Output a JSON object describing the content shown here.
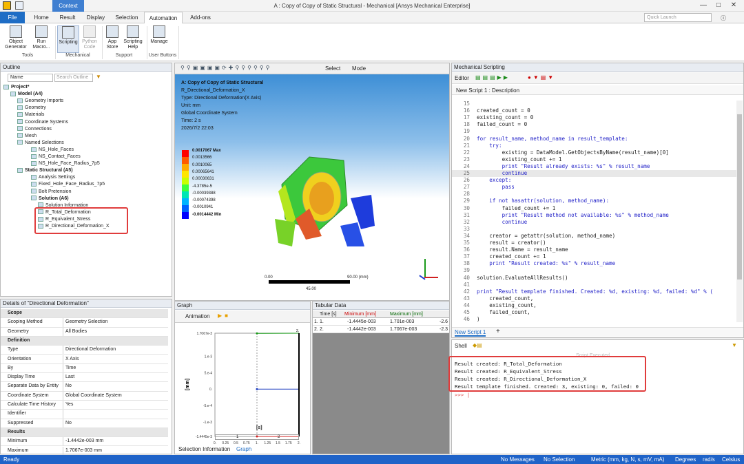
{
  "titlebar": {
    "context": "Context",
    "title": "A : Copy of Copy of Static Structural - Mechanical [Ansys Mechanical Enterprise]"
  },
  "ribbon_tabs": [
    "File",
    "Home",
    "Result",
    "Display",
    "Selection",
    "Automation",
    "Add-ons"
  ],
  "quick_launch": "Quick Launch",
  "ribbon": {
    "buttons": [
      {
        "label": "Object\nGenerator"
      },
      {
        "label": "Run\nMacro..."
      },
      {
        "label": "Scripting"
      },
      {
        "label": "Python\nCode"
      },
      {
        "label": "App\nStore"
      },
      {
        "label": "Scripting\nHelp"
      },
      {
        "label": "Manage"
      }
    ],
    "groups": [
      "Tools",
      "Mechanical",
      "Support",
      "User Buttons"
    ]
  },
  "outline": {
    "title": "Outline",
    "name_label": "Name",
    "search_placeholder": "Search Outline",
    "tree": [
      {
        "label": "Project*",
        "bold": true
      },
      {
        "label": "Model (A4)",
        "bold": true
      },
      {
        "label": "Geometry Imports"
      },
      {
        "label": "Geometry"
      },
      {
        "label": "Materials"
      },
      {
        "label": "Coordinate Systems"
      },
      {
        "label": "Connections"
      },
      {
        "label": "Mesh"
      },
      {
        "label": "Named Selections"
      },
      {
        "label": "NS_Hole_Faces"
      },
      {
        "label": "NS_Contact_Faces"
      },
      {
        "label": "NS_Hole_Face_Radius_7p5"
      },
      {
        "label": "Static Structural (A5)",
        "bold": true
      },
      {
        "label": "Analysis Settings"
      },
      {
        "label": "Fixed_Hole_Face_Radius_7p5"
      },
      {
        "label": "Bolt Pretension"
      },
      {
        "label": "Solution (A6)",
        "bold": true
      },
      {
        "label": "Solution Information"
      },
      {
        "label": "R_Total_Deformation"
      },
      {
        "label": "R_Equivalent_Stress"
      },
      {
        "label": "R_Directional_Deformation_X"
      }
    ]
  },
  "details": {
    "title": "Details of \"Directional Deformation\"",
    "rows": [
      {
        "k": "Scope",
        "v": "",
        "sec": true
      },
      {
        "k": "Scoping Method",
        "v": "Geometry Selection"
      },
      {
        "k": "Geometry",
        "v": "All Bodies"
      },
      {
        "k": "Definition",
        "v": "",
        "sec": true
      },
      {
        "k": "Type",
        "v": "Directional Deformation"
      },
      {
        "k": "Orientation",
        "v": "X Axis"
      },
      {
        "k": "By",
        "v": "Time"
      },
      {
        "k": "Display Time",
        "v": "Last"
      },
      {
        "k": "Separate Data by Entity",
        "v": "No"
      },
      {
        "k": "Coordinate System",
        "v": "Global Coordinate System"
      },
      {
        "k": "Calculate Time History",
        "v": "Yes"
      },
      {
        "k": "Identifier",
        "v": ""
      },
      {
        "k": "Suppressed",
        "v": "No"
      },
      {
        "k": "Results",
        "v": "",
        "sec": true
      },
      {
        "k": "Minimum",
        "v": "-1.4442e-003 mm"
      },
      {
        "k": "Maximum",
        "v": "1.7067e-003 mm"
      }
    ]
  },
  "viewport": {
    "select": "Select",
    "mode": "Mode",
    "info": [
      "A: Copy of Copy of Static Structural",
      "R_Directional_Deformation_X",
      "Type: Directional Deformation(X Axis)",
      "Unit: mm",
      "Global Coordinate System",
      "Time: 2 s",
      "2026/7/2 22:03"
    ],
    "legend": [
      "0.0017067 Max",
      "0.0013566",
      "0.0010065",
      "0.00065641",
      "0.00030631",
      "-4.3785e-5",
      "-0.00039388",
      "-0.00074398",
      "-0.0010941",
      "-0.0014442 Min"
    ],
    "legend_colors": [
      "#ff0000",
      "#ff5a00",
      "#ffaa00",
      "#ffe600",
      "#c8ff00",
      "#3cff3c",
      "#00e6b4",
      "#00b4ff",
      "#0064ff",
      "#0000ff"
    ],
    "scale": {
      "left": "0.00",
      "right": "90.00 (mm)",
      "mid": "45.00"
    }
  },
  "graph": {
    "title": "Graph",
    "animation": "Animation",
    "ylabel": "[mm]",
    "xlabel": "[s]",
    "yticks": [
      "1.7067e-3",
      "1.e-3",
      "5.e-4",
      "0.",
      "-5.e-4",
      "-1.e-3",
      "-1.4445e-3"
    ],
    "xticks": [
      "0.",
      "0.25",
      "0.5",
      "0.75",
      "1.",
      "1.25",
      "1.5",
      "1.75",
      "2."
    ],
    "bottom": [
      "1",
      "2"
    ],
    "tabs": [
      "Selection Information",
      "Graph"
    ]
  },
  "tabular": {
    "title": "Tabular Data",
    "headers": [
      "Time [s]",
      "Minimum [mm]",
      "Maximum [mm]"
    ],
    "rows": [
      [
        "1.",
        "1.",
        "-1.4445e-003",
        "1.701e-003",
        "-2.6"
      ],
      [
        "2.",
        "2.",
        "-1.4442e-003",
        "1.7067e-003",
        "-2.3"
      ]
    ]
  },
  "scripting": {
    "title": "Mechanical Scripting",
    "editor": "Editor",
    "doc_tab": "New Script 1 : Description",
    "bottom_tab": "New Script 1",
    "lines": [
      {
        "n": "15",
        "t": ""
      },
      {
        "n": "16",
        "t": "created_count = 0"
      },
      {
        "n": "17",
        "t": "existing_count = 0"
      },
      {
        "n": "18",
        "t": "failed_count = 0"
      },
      {
        "n": "19",
        "t": ""
      },
      {
        "n": "20",
        "t": "for result_name, method_name in result_template:"
      },
      {
        "n": "21",
        "t": "    try:"
      },
      {
        "n": "22",
        "t": "        existing = DataModel.GetObjectsByName(result_name)[0]"
      },
      {
        "n": "23",
        "t": "        existing_count += 1"
      },
      {
        "n": "24",
        "t": "        print \"Result already exists: %s\" % result_name"
      },
      {
        "n": "25",
        "t": "        continue"
      },
      {
        "n": "26",
        "t": "    except:"
      },
      {
        "n": "27",
        "t": "        pass"
      },
      {
        "n": "28",
        "t": ""
      },
      {
        "n": "29",
        "t": "    if not hasattr(solution, method_name):"
      },
      {
        "n": "30",
        "t": "        failed_count += 1"
      },
      {
        "n": "31",
        "t": "        print \"Result method not available: %s\" % method_name"
      },
      {
        "n": "32",
        "t": "        continue"
      },
      {
        "n": "33",
        "t": ""
      },
      {
        "n": "34",
        "t": "    creator = getattr(solution, method_name)"
      },
      {
        "n": "35",
        "t": "    result = creator()"
      },
      {
        "n": "36",
        "t": "    result.Name = result_name"
      },
      {
        "n": "37",
        "t": "    created_count += 1"
      },
      {
        "n": "38",
        "t": "    print \"Result created: %s\" % result_name"
      },
      {
        "n": "39",
        "t": ""
      },
      {
        "n": "40",
        "t": "solution.EvaluateAllResults()"
      },
      {
        "n": "41",
        "t": ""
      },
      {
        "n": "42",
        "t": "print \"Result template finished. Created: %d, existing: %d, failed: %d\" % ("
      },
      {
        "n": "43",
        "t": "    created_count,"
      },
      {
        "n": "44",
        "t": "    existing_count,"
      },
      {
        "n": "45",
        "t": "    failed_count,"
      },
      {
        "n": "46",
        "t": ")"
      }
    ]
  },
  "shell": {
    "title": "Shell",
    "executed": "Script Executed",
    "lines": [
      "Result created: R_Total_Deformation",
      "Result created: R_Equivalent_Stress",
      "Result created: R_Directional_Deformation_X",
      "Result template finished. Created: 3, existing: 0, failed: 0"
    ],
    "prompt": ">>> |"
  },
  "status": {
    "ready": "Ready",
    "messages": "No Messages",
    "selection": "No Selection",
    "units": "Metric (mm, kg, N, s, mV, mA)",
    "angle": "Degrees",
    "rate": "rad/s",
    "temp": "Celsius"
  }
}
